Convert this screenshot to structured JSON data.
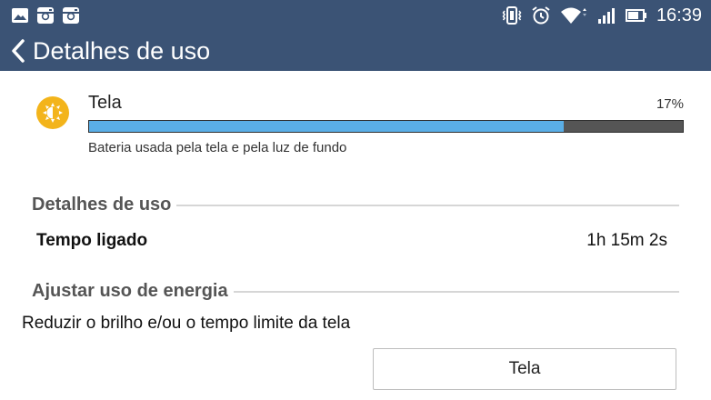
{
  "status_bar": {
    "time": "16:39",
    "left_icons": [
      "gallery-icon",
      "instagram-icon",
      "instagram-icon"
    ],
    "right_icons": [
      "vibrate-icon",
      "alarm-icon",
      "wifi-icon",
      "signal-icon",
      "battery-icon"
    ]
  },
  "header": {
    "title": "Detalhes de uso"
  },
  "usage": {
    "name": "Tela",
    "percent": "17%",
    "percent_value": 0.8,
    "description": "Bateria usada pela tela e pela luz de fundo",
    "icon": "sun-icon"
  },
  "details_section": {
    "title": "Detalhes de uso",
    "rows": [
      {
        "label": "Tempo ligado",
        "value": "1h 15m 2s"
      }
    ]
  },
  "adjust_section": {
    "title": "Ajustar uso de energia",
    "advice": "Reduzir o brilho e/ou o tempo limite da tela",
    "button_label": "Tela"
  },
  "colors": {
    "header_bg": "#3b5375",
    "bar_fill": "#5aaee6",
    "bar_track": "#555555",
    "icon_yellow": "#f3b41b"
  }
}
